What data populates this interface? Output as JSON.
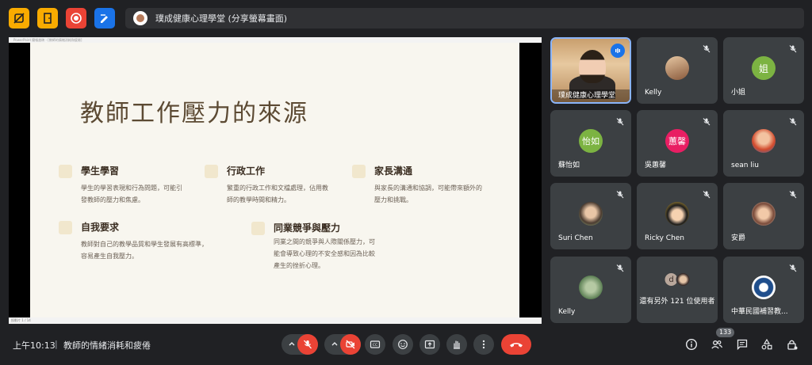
{
  "topbar": {
    "presenter_chip": "璞成健康心理學堂 (分享螢幕畫面)"
  },
  "ppt": {
    "titlebar_text": "PowerPoint 簡報放映 - [教師的情緒消耗和疲倦]",
    "status_text": "投影片 1 / 14"
  },
  "slide": {
    "title": "教師工作壓力的來源",
    "topics": [
      {
        "heading": "學生學習",
        "lines": [
          "學生的學習表現和行為問題，可能引",
          "發教師的壓力和焦慮。"
        ]
      },
      {
        "heading": "行政工作",
        "lines": [
          "繁重的行政工作和文檔處理，佔用教",
          "師的教學時間和精力。"
        ]
      },
      {
        "heading": "家長溝通",
        "lines": [
          "與家長的溝通和協調，可能帶來額外的",
          "壓力和挑戰。"
        ]
      },
      {
        "heading": "自我要求",
        "lines": [
          "教師對自己的教學品質和學生發展有高標準，",
          "容易產生自我壓力。"
        ]
      },
      {
        "heading": "同業競爭與壓力",
        "lines": [
          "同業之間的競爭與人際關係壓力，可",
          "能會導致心理的不安全感和因為比較",
          "產生的挫折心理。"
        ]
      }
    ]
  },
  "participants": [
    {
      "name": "璞成健康心理學堂",
      "type": "video"
    },
    {
      "name": "Kelly",
      "type": "photo"
    },
    {
      "name": "小姐",
      "type": "initial",
      "initial": "姐",
      "color": "#7cb342"
    },
    {
      "name": "蘇怡如",
      "type": "initial",
      "initial": "怡如",
      "color": "#7cb342"
    },
    {
      "name": "吳蕙馨",
      "type": "initial",
      "initial": "蕙馨",
      "color": "#e91e63"
    },
    {
      "name": "sean liu",
      "type": "photo"
    },
    {
      "name": "Suri Chen",
      "type": "photo"
    },
    {
      "name": "Ricky Chen",
      "type": "photo"
    },
    {
      "name": "安爵",
      "type": "photo"
    },
    {
      "name": "Kelly",
      "type": "photo"
    },
    {
      "name": "還有另外 121 位使用者",
      "type": "more",
      "initial": "d"
    },
    {
      "name": "中華民國補習教...",
      "type": "photo"
    }
  ],
  "bottom": {
    "time": "上午10:13",
    "separator": "|",
    "meeting_title": "教師的情緒消耗和疲倦",
    "participant_count": "133"
  },
  "colors": {
    "accent_blue": "#8ab4f8",
    "red": "#ea4335",
    "yellow": "#f9ab00"
  }
}
